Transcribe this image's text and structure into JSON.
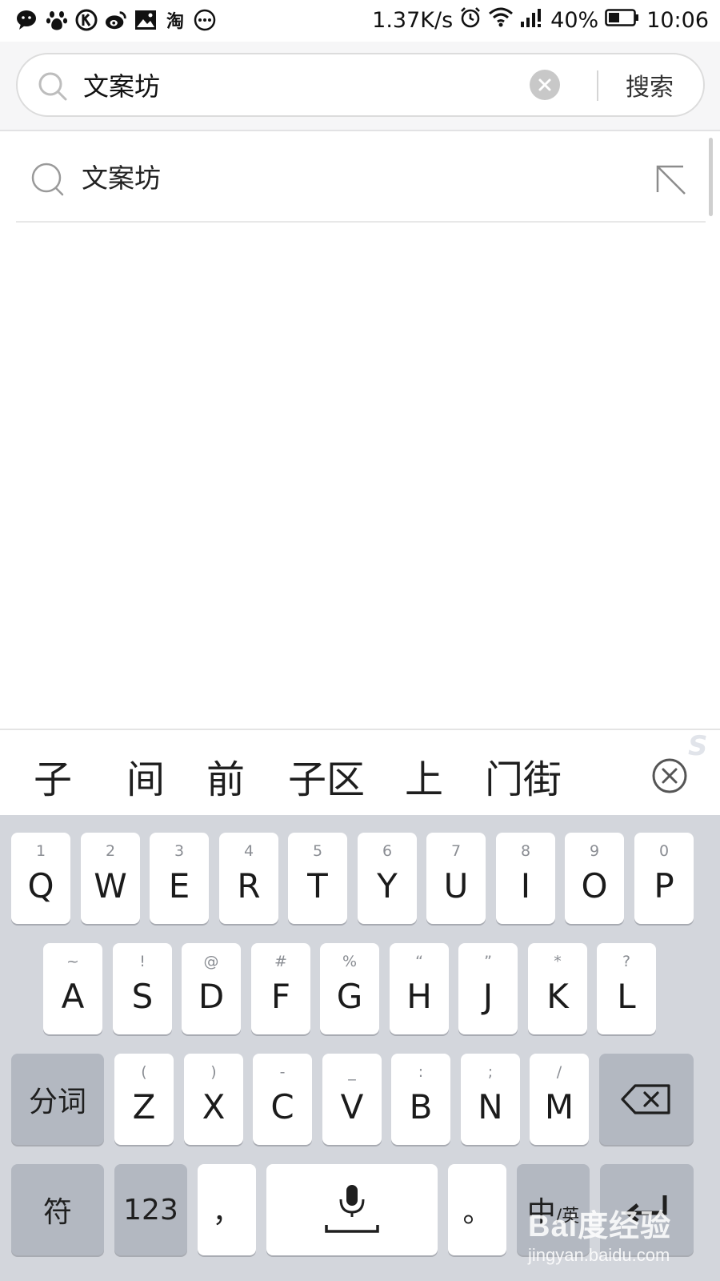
{
  "status_bar": {
    "app_icons": [
      "wechat-icon",
      "baidu-paw-icon",
      "k-icon",
      "weibo-icon",
      "gallery-icon",
      "taobao-icon",
      "more-dots-icon"
    ],
    "taobao_glyph": "淘",
    "net_speed": "1.37K/s",
    "battery_percent": "40%",
    "time": "10:06"
  },
  "search": {
    "query": "文案坊",
    "submit_label": "搜索"
  },
  "suggestions": [
    {
      "text": "文案坊"
    }
  ],
  "candidates": [
    "子",
    "间",
    "前",
    "子区",
    "上",
    "门街"
  ],
  "keyboard": {
    "row1": [
      {
        "sub": "1",
        "main": "Q"
      },
      {
        "sub": "2",
        "main": "W"
      },
      {
        "sub": "3",
        "main": "E"
      },
      {
        "sub": "4",
        "main": "R"
      },
      {
        "sub": "5",
        "main": "T"
      },
      {
        "sub": "6",
        "main": "Y"
      },
      {
        "sub": "7",
        "main": "U"
      },
      {
        "sub": "8",
        "main": "I"
      },
      {
        "sub": "9",
        "main": "O"
      },
      {
        "sub": "0",
        "main": "P"
      }
    ],
    "row2": [
      {
        "sub": "~",
        "main": "A"
      },
      {
        "sub": "!",
        "main": "S"
      },
      {
        "sub": "@",
        "main": "D"
      },
      {
        "sub": "#",
        "main": "F"
      },
      {
        "sub": "%",
        "main": "G"
      },
      {
        "sub": "“",
        "main": "H"
      },
      {
        "sub": "”",
        "main": "J"
      },
      {
        "sub": "*",
        "main": "K"
      },
      {
        "sub": "?",
        "main": "L"
      }
    ],
    "row3": [
      {
        "sub": "(",
        "main": "Z"
      },
      {
        "sub": ")",
        "main": "X"
      },
      {
        "sub": "-",
        "main": "C"
      },
      {
        "sub": "_",
        "main": "V"
      },
      {
        "sub": ":",
        "main": "B"
      },
      {
        "sub": ";",
        "main": "N"
      },
      {
        "sub": "/",
        "main": "M"
      }
    ],
    "segment_label": "分词",
    "symbols_label": "符",
    "numbers_label": "123",
    "comma_label": "，",
    "period_label": "。",
    "lang_toggle_main": "中",
    "lang_toggle_sub": "/英"
  },
  "watermark": {
    "brand": "Bai度经验",
    "url": "jingyan.baidu.com"
  }
}
